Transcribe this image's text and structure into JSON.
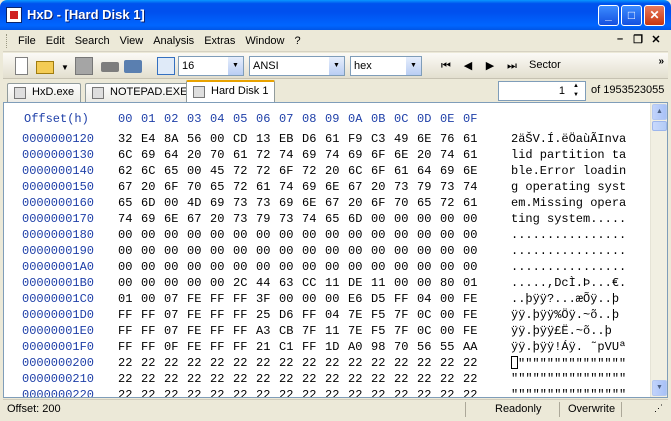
{
  "window": {
    "title": "HxD - [Hard Disk 1]"
  },
  "menu": {
    "items": [
      "File",
      "Edit",
      "Search",
      "View",
      "Analysis",
      "Extras",
      "Window",
      "?"
    ]
  },
  "toolbar": {
    "bytes_per_row": "16",
    "charset": "ANSI",
    "offset_base": "hex",
    "sector_label": "Sector"
  },
  "tabs": [
    {
      "label": "HxD.exe",
      "icon": "file-icon",
      "active": false
    },
    {
      "label": "NOTEPAD.EXE",
      "icon": "file-icon",
      "active": false
    },
    {
      "label": "Hard Disk 1",
      "icon": "disk-icon",
      "active": true
    }
  ],
  "sector_nav": {
    "current": "1",
    "total": "of 1953523055"
  },
  "hex": {
    "offset_header": "Offset(h)",
    "columns": [
      "00",
      "01",
      "02",
      "03",
      "04",
      "05",
      "06",
      "07",
      "08",
      "09",
      "0A",
      "0B",
      "0C",
      "0D",
      "0E",
      "0F"
    ],
    "rows": [
      {
        "offset": "0000000120",
        "bytes": [
          "32",
          "E4",
          "8A",
          "56",
          "00",
          "CD",
          "13",
          "EB",
          "D6",
          "61",
          "F9",
          "C3",
          "49",
          "6E",
          "76",
          "61"
        ],
        "text": "2äŠV.Í.ëÖaùÃInva"
      },
      {
        "offset": "0000000130",
        "bytes": [
          "6C",
          "69",
          "64",
          "20",
          "70",
          "61",
          "72",
          "74",
          "69",
          "74",
          "69",
          "6F",
          "6E",
          "20",
          "74",
          "61"
        ],
        "text": "lid partition ta"
      },
      {
        "offset": "0000000140",
        "bytes": [
          "62",
          "6C",
          "65",
          "00",
          "45",
          "72",
          "72",
          "6F",
          "72",
          "20",
          "6C",
          "6F",
          "61",
          "64",
          "69",
          "6E"
        ],
        "text": "ble.Error loadin"
      },
      {
        "offset": "0000000150",
        "bytes": [
          "67",
          "20",
          "6F",
          "70",
          "65",
          "72",
          "61",
          "74",
          "69",
          "6E",
          "67",
          "20",
          "73",
          "79",
          "73",
          "74"
        ],
        "text": "g operating syst"
      },
      {
        "offset": "0000000160",
        "bytes": [
          "65",
          "6D",
          "00",
          "4D",
          "69",
          "73",
          "73",
          "69",
          "6E",
          "67",
          "20",
          "6F",
          "70",
          "65",
          "72",
          "61"
        ],
        "text": "em.Missing opera"
      },
      {
        "offset": "0000000170",
        "bytes": [
          "74",
          "69",
          "6E",
          "67",
          "20",
          "73",
          "79",
          "73",
          "74",
          "65",
          "6D",
          "00",
          "00",
          "00",
          "00",
          "00"
        ],
        "text": "ting system....."
      },
      {
        "offset": "0000000180",
        "bytes": [
          "00",
          "00",
          "00",
          "00",
          "00",
          "00",
          "00",
          "00",
          "00",
          "00",
          "00",
          "00",
          "00",
          "00",
          "00",
          "00"
        ],
        "text": "................"
      },
      {
        "offset": "0000000190",
        "bytes": [
          "00",
          "00",
          "00",
          "00",
          "00",
          "00",
          "00",
          "00",
          "00",
          "00",
          "00",
          "00",
          "00",
          "00",
          "00",
          "00"
        ],
        "text": "................"
      },
      {
        "offset": "00000001A0",
        "bytes": [
          "00",
          "00",
          "00",
          "00",
          "00",
          "00",
          "00",
          "00",
          "00",
          "00",
          "00",
          "00",
          "00",
          "00",
          "00",
          "00"
        ],
        "text": "................"
      },
      {
        "offset": "00000001B0",
        "bytes": [
          "00",
          "00",
          "00",
          "00",
          "00",
          "2C",
          "44",
          "63",
          "CC",
          "11",
          "DE",
          "11",
          "00",
          "00",
          "80",
          "01"
        ],
        "text": ".....,DcÌ.Þ...€."
      },
      {
        "offset": "00000001C0",
        "bytes": [
          "01",
          "00",
          "07",
          "FE",
          "FF",
          "FF",
          "3F",
          "00",
          "00",
          "00",
          "E6",
          "D5",
          "FF",
          "04",
          "00",
          "FE"
        ],
        "text": "..þÿÿ?...æÕÿ..þ"
      },
      {
        "offset": "00000001D0",
        "bytes": [
          "FF",
          "FF",
          "07",
          "FE",
          "FF",
          "FF",
          "25",
          "D6",
          "FF",
          "04",
          "7E",
          "F5",
          "7F",
          "0C",
          "00",
          "FE"
        ],
        "text": "ÿÿ.þÿÿ%Öÿ.~õ..þ"
      },
      {
        "offset": "00000001E0",
        "bytes": [
          "FF",
          "FF",
          "07",
          "FE",
          "FF",
          "FF",
          "A3",
          "CB",
          "7F",
          "11",
          "7E",
          "F5",
          "7F",
          "0C",
          "00",
          "FE"
        ],
        "text": "ÿÿ.þÿÿ£Ë.~õ..þ"
      },
      {
        "offset": "00000001F0",
        "bytes": [
          "FF",
          "FF",
          "0F",
          "FE",
          "FF",
          "FF",
          "21",
          "C1",
          "FF",
          "1D",
          "A0",
          "98",
          "70",
          "56",
          "55",
          "AA"
        ],
        "text": "ÿÿ.þÿÿ!Áÿ. ˜pVUª"
      },
      {
        "offset": "0000000200",
        "bytes": [
          "22",
          "22",
          "22",
          "22",
          "22",
          "22",
          "22",
          "22",
          "22",
          "22",
          "22",
          "22",
          "22",
          "22",
          "22",
          "22"
        ],
        "text": "\"\"\"\"\"\"\"\"\"\"\"\"\"\"\""
      },
      {
        "offset": "0000000210",
        "bytes": [
          "22",
          "22",
          "22",
          "22",
          "22",
          "22",
          "22",
          "22",
          "22",
          "22",
          "22",
          "22",
          "22",
          "22",
          "22",
          "22"
        ],
        "text": "\"\"\"\"\"\"\"\"\"\"\"\"\"\"\"\""
      },
      {
        "offset": "0000000220",
        "bytes": [
          "22",
          "22",
          "22",
          "22",
          "22",
          "22",
          "22",
          "22",
          "22",
          "22",
          "22",
          "22",
          "22",
          "22",
          "22",
          "22"
        ],
        "text": "\"\"\"\"\"\"\"\"\"\"\"\"\"\"\"\""
      }
    ]
  },
  "status": {
    "offset": "Offset: 200",
    "mode_readonly": "Readonly",
    "mode_overwrite": "Overwrite"
  }
}
